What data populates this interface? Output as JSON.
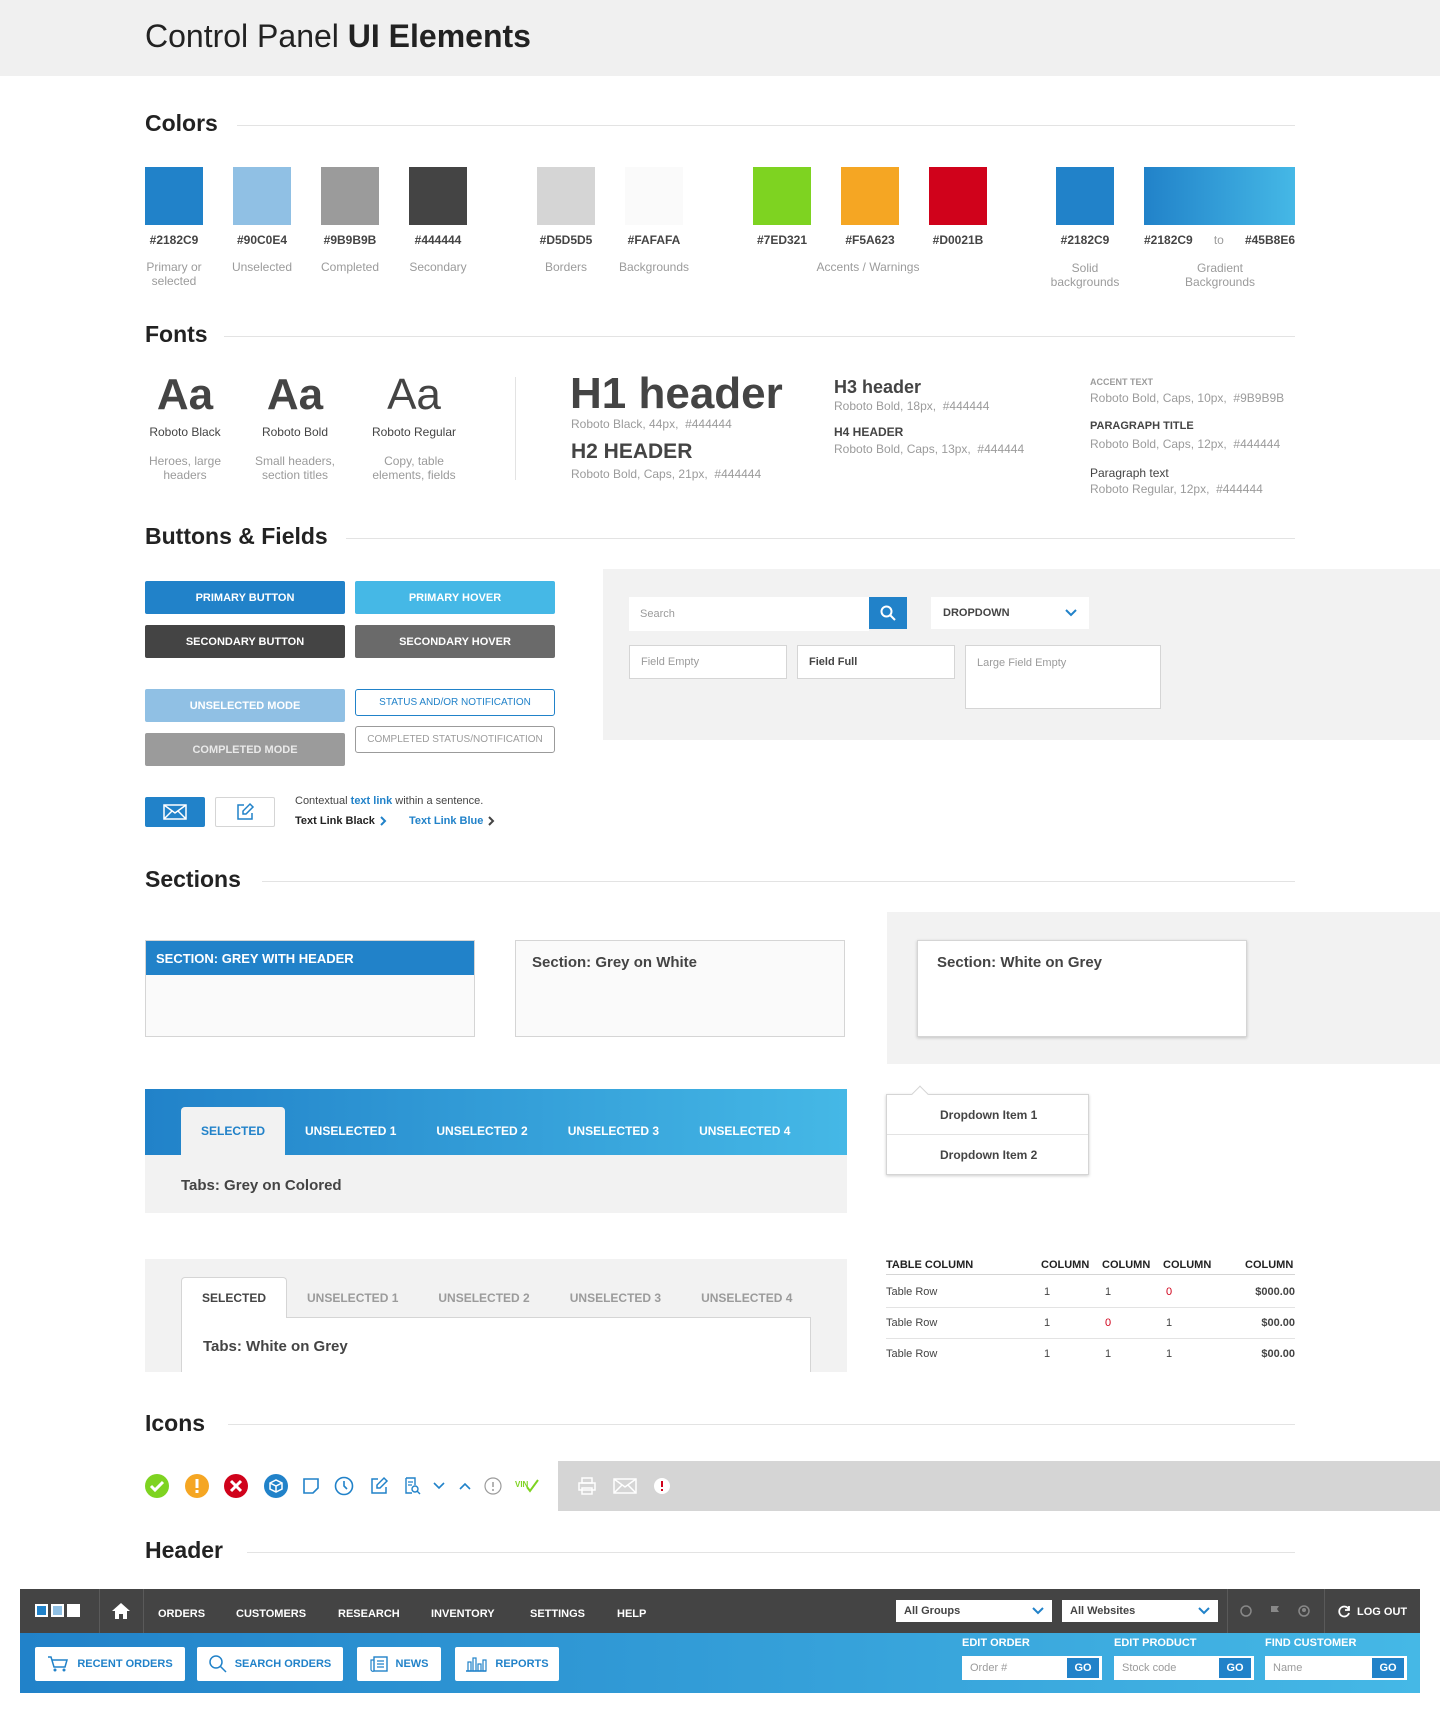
{
  "page": {
    "title_light": "Control Panel",
    "title_bold": "UI Elements"
  },
  "sections": {
    "colors": "Colors",
    "fonts": "Fonts",
    "buttons": "Buttons & Fields",
    "sections": "Sections",
    "icons": "Icons",
    "header": "Header"
  },
  "colors": {
    "swatches": [
      {
        "hex": "#2182C9",
        "label": "Primary or selected"
      },
      {
        "hex": "#90C0E4",
        "label": "Unselected"
      },
      {
        "hex": "#9B9B9B",
        "label": "Completed"
      },
      {
        "hex": "#444444",
        "label": "Secondary"
      },
      {
        "hex": "#D5D5D5",
        "label": "Borders"
      },
      {
        "hex": "#FAFAFA",
        "label": "Backgrounds"
      },
      {
        "hex": "#7ED321",
        "label": ""
      },
      {
        "hex": "#F5A623",
        "label": ""
      },
      {
        "hex": "#D0021B",
        "label": ""
      },
      {
        "hex": "#2182C9",
        "label": "Solid backgrounds"
      }
    ],
    "accents_label": "Accents / Warnings",
    "gradient": {
      "from": "#2182C9",
      "to_word": "to",
      "to": "#45B8E6",
      "label": "Gradient Backgrounds"
    }
  },
  "fonts": {
    "samples": [
      {
        "glyph": "Aa",
        "name": "Roboto Black",
        "desc": "Heroes, large headers"
      },
      {
        "glyph": "Aa",
        "name": "Roboto Bold",
        "desc": "Small headers, section titles"
      },
      {
        "glyph": "Aa",
        "name": "Roboto Regular",
        "desc": "Copy, table elements, fields"
      }
    ],
    "h1": {
      "text": "H1 header",
      "spec": "Roboto Black, 44px,  #444444"
    },
    "h2": {
      "text": "H2 HEADER",
      "spec": "Roboto Bold, Caps, 21px,  #444444"
    },
    "h3": {
      "text": "H3 header",
      "spec": "Roboto Bold, 18px,  #444444"
    },
    "h4": {
      "text": "H4 HEADER",
      "spec": "Roboto Bold, Caps, 13px,  #444444"
    },
    "accent": {
      "text": "ACCENT TEXT",
      "spec": "Roboto Bold, Caps, 10px,  #9B9B9B"
    },
    "ptitle": {
      "text": "PARAGRAPH TITLE",
      "spec": "Roboto Bold, Caps, 12px,  #444444"
    },
    "ptext": {
      "text": "Paragraph text",
      "spec": "Roboto Regular, 12px,  #444444"
    }
  },
  "buttons": {
    "primary": "PRIMARY BUTTON",
    "primary_hover": "PRIMARY HOVER",
    "secondary": "SECONDARY BUTTON",
    "secondary_hover": "SECONDARY HOVER",
    "unselected": "UNSELECTED MODE",
    "status": "STATUS AND/OR NOTIFICATION",
    "completed": "COMPLETED MODE",
    "completed_status": "COMPLETED STATUS/NOTIFICATION",
    "contextual_pre": "Contextual",
    "contextual_link": "text link",
    "contextual_post": "within a sentence.",
    "link_black": "Text Link Black",
    "link_blue": "Text Link Blue"
  },
  "fields": {
    "search_placeholder": "Search",
    "dropdown": "DROPDOWN",
    "field_empty": "Field Empty",
    "field_full": "Field Full",
    "large_empty": "Large Field Empty"
  },
  "sectionsdemo": {
    "grey_header": "SECTION: GREY WITH HEADER",
    "grey_on_white": "Section: Grey on White",
    "white_on_grey": "Section: White on Grey"
  },
  "tabs_colored": {
    "tabs": [
      "SELECTED",
      "UNSELECTED 1",
      "UNSELECTED 2",
      "UNSELECTED 3",
      "UNSELECTED 4"
    ],
    "content": "Tabs: Grey on Colored"
  },
  "tabs_grey": {
    "tabs": [
      "SELECTED",
      "UNSELECTED 1",
      "UNSELECTED 2",
      "UNSELECTED 3",
      "UNSELECTED 4"
    ],
    "content": "Tabs: White on Grey"
  },
  "dropdown_menu": [
    "Dropdown Item 1",
    "Dropdown Item 2"
  ],
  "table": {
    "headers": [
      "TABLE COLUMN",
      "COLUMN",
      "COLUMN",
      "COLUMN",
      "COLUMN"
    ],
    "rows": [
      [
        "Table Row",
        "1",
        "1",
        "0",
        "$000.00"
      ],
      [
        "Table Row",
        "1",
        "0",
        "1",
        "$00.00"
      ],
      [
        "Table Row",
        "1",
        "1",
        "1",
        "$00.00"
      ]
    ],
    "highlight_color": "#D0021B"
  },
  "icons": {
    "row": [
      "check-circle-icon",
      "warning-circle-icon",
      "error-circle-icon",
      "package-icon",
      "note-icon",
      "clock-icon",
      "edit-icon",
      "document-search-icon",
      "chevron-down-icon",
      "chevron-up-icon",
      "info-icon",
      "vin-check-icon"
    ],
    "grey_row": [
      "print-icon",
      "mail-icon",
      "alert-icon"
    ]
  },
  "header": {
    "nav": [
      "ORDERS",
      "CUSTOMERS",
      "RESEARCH",
      "INVENTORY",
      "SETTINGS",
      "HELP"
    ],
    "groups_select": "All Groups",
    "websites_select": "All Websites",
    "logout": "LOG OUT",
    "quick": [
      "RECENT ORDERS",
      "SEARCH ORDERS",
      "NEWS",
      "REPORTS"
    ],
    "edit_order": {
      "label": "EDIT ORDER",
      "placeholder": "Order #",
      "go": "GO"
    },
    "edit_product": {
      "label": "EDIT PRODUCT",
      "placeholder": "Stock code",
      "go": "GO"
    },
    "find_customer": {
      "label": "FIND CUSTOMER",
      "placeholder": "Name",
      "go": "GO"
    }
  }
}
